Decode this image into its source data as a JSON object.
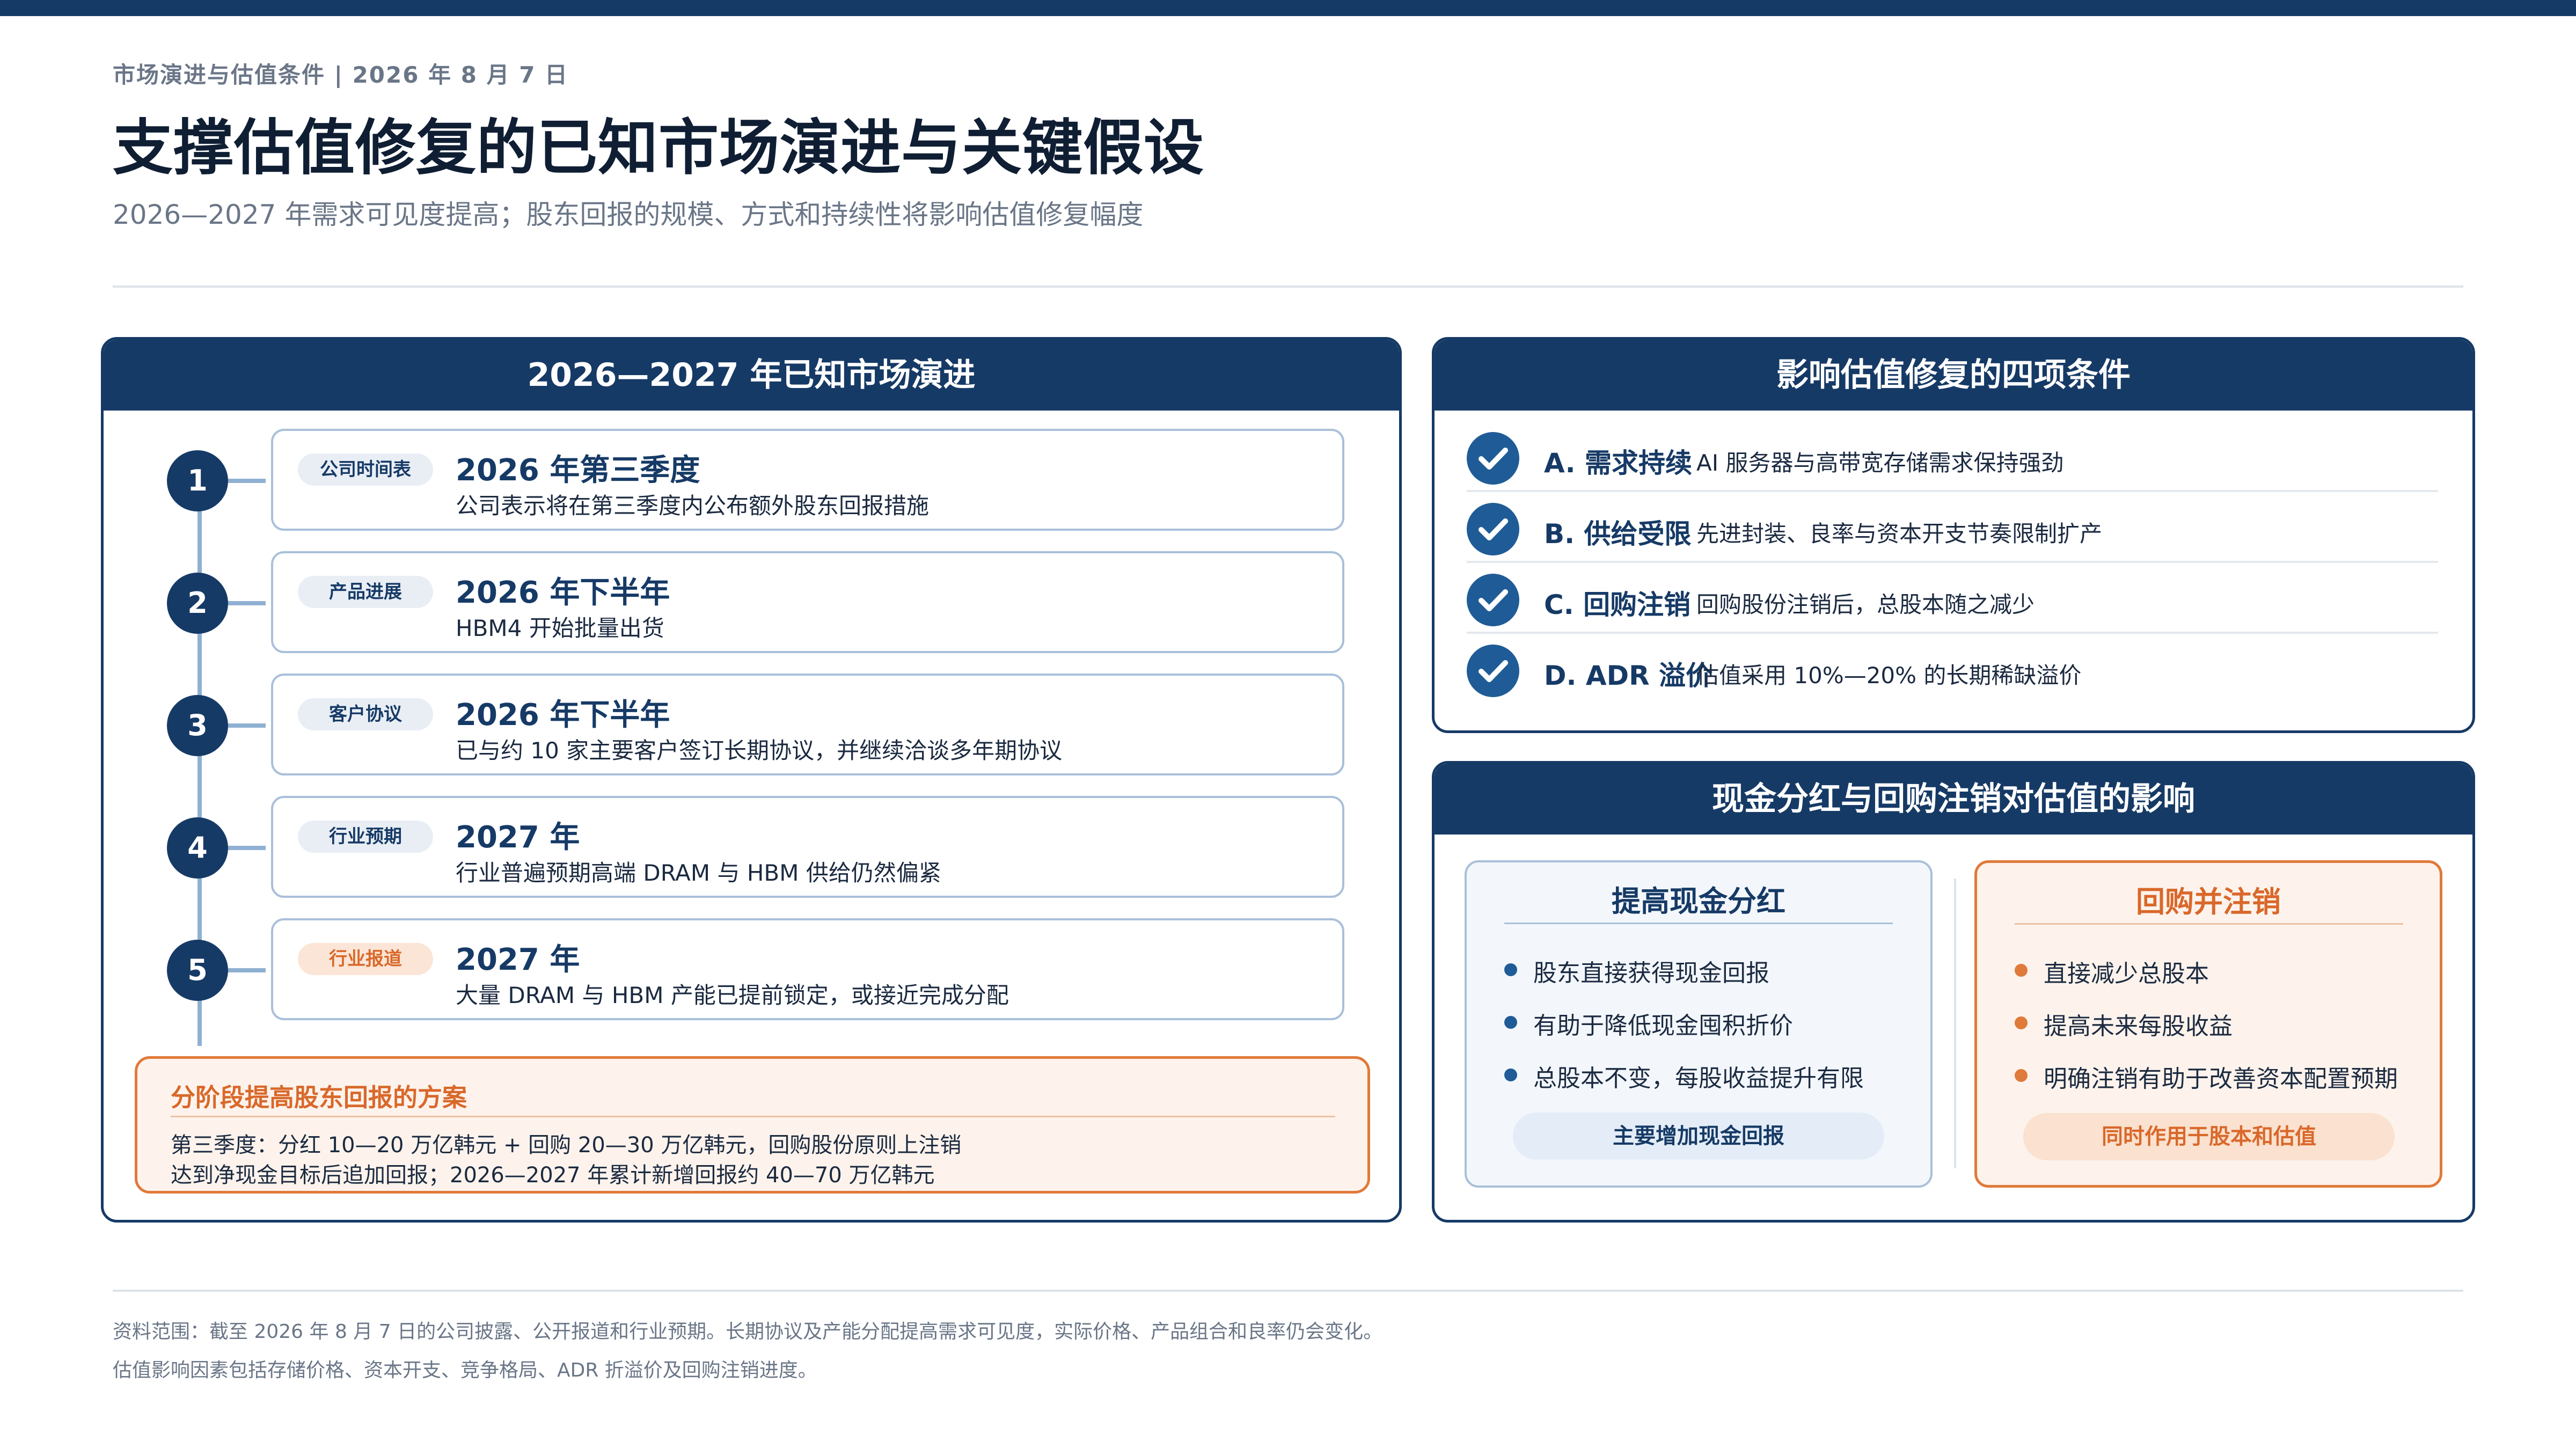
{
  "header": {
    "kicker": "市场演进与估值条件 | 2026 年 8 月 7 日",
    "title": "支撑估值修复的已知市场演进与关键假设",
    "subtitle": "2026—2027 年需求可见度提高；股东回报的规模、方式和持续性将影响估值修复幅度"
  },
  "timeline": {
    "heading": "2026—2027 年已知市场演进",
    "steps": [
      {
        "number": "1",
        "tag": "公司时间表",
        "title": "2026 年第三季度",
        "desc": "公司表示将在第三季度内公布额外股东回报措施"
      },
      {
        "number": "2",
        "tag": "产品进展",
        "title": "2026 年下半年",
        "desc": "HBM4 开始批量出货"
      },
      {
        "number": "3",
        "tag": "客户协议",
        "title": "2026 年下半年",
        "desc": "已与约 10 家主要客户签订长期协议，并继续洽谈多年期协议"
      },
      {
        "number": "4",
        "tag": "行业预期",
        "title": "2027 年",
        "desc": "行业普遍预期高端 DRAM 与 HBM 供给仍然偏紧"
      },
      {
        "number": "5",
        "tag": "行业报道",
        "title": "2027 年",
        "desc": "大量 DRAM 与 HBM 产能已提前锁定，或接近完成分配"
      }
    ],
    "plan": {
      "title": "分阶段提高股东回报的方案",
      "line1": "第三季度：分红 10—20 万亿韩元 + 回购 20—30 万亿韩元，回购股份原则上注销",
      "line2": "达到净现金目标后追加回报；2026—2027 年累计新增回报约 40—70 万亿韩元"
    }
  },
  "conditions": {
    "heading": "影响估值修复的四项条件",
    "items": [
      {
        "label": "A. 需求持续",
        "desc": "AI 服务器与高带宽存储需求保持强劲",
        "icon": "check-icon"
      },
      {
        "label": "B. 供给受限",
        "desc": "先进封装、良率与资本开支节奏限制扩产",
        "icon": "check-icon"
      },
      {
        "label": "C. 回购注销",
        "desc": "回购股份注销后，总股本随之减少",
        "icon": "check-icon"
      },
      {
        "label": "D. ADR 溢价",
        "desc": "估值采用 10%—20% 的长期稀缺溢价",
        "icon": "check-icon"
      }
    ]
  },
  "impact": {
    "heading": "现金分红与回购注销对估值的影响",
    "dividend": {
      "title": "提高现金分红",
      "bullets": [
        "股东直接获得现金回报",
        "有助于降低现金囤积折价",
        "总股本不变，每股收益提升有限"
      ],
      "summary": "主要增加现金回报"
    },
    "buyback": {
      "title": "回购并注销",
      "bullets": [
        "直接减少总股本",
        "提高未来每股收益",
        "明确注销有助于改善资本配置预期"
      ],
      "summary": "同时作用于股本和估值"
    }
  },
  "footer": {
    "note1": "资料范围：截至 2026 年 8 月 7 日的公司披露、公开报道和行业预期。长期协议及产能分配提高需求可见度，实际价格、产品组合和良率仍会变化。",
    "note2": "估值影响因素包括存储价格、资本开支、竞争格局、ADR 折溢价及回购注销进度。"
  },
  "colors": {
    "navy": "#163a66",
    "accent_blue": "#1f5c97",
    "accent_orange": "#e07a3a",
    "muted_text": "#6a7687"
  }
}
